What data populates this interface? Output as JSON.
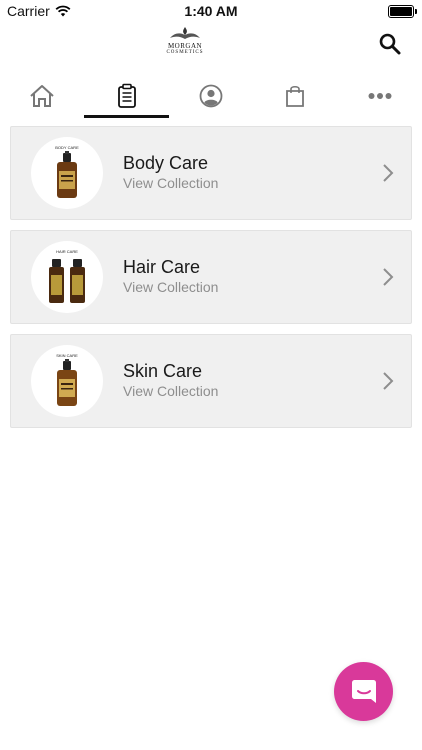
{
  "status_bar": {
    "carrier": "Carrier",
    "time": "1:40 AM"
  },
  "header": {
    "logo_brand": "MORGAN",
    "logo_sub": "COSMETICS",
    "search_icon": "search-icon"
  },
  "tabs": [
    {
      "icon": "home-icon",
      "active": false
    },
    {
      "icon": "clipboard-icon",
      "active": true
    },
    {
      "icon": "profile-icon",
      "active": false
    },
    {
      "icon": "shopping-bag-icon",
      "active": false
    },
    {
      "icon": "more-icon",
      "active": false
    }
  ],
  "collections": [
    {
      "title": "Body Care",
      "subtitle": "View Collection",
      "thumb_label": "BODY CARE"
    },
    {
      "title": "Hair Care",
      "subtitle": "View Collection",
      "thumb_label": "HAIR CARE"
    },
    {
      "title": "Skin Care",
      "subtitle": "View Collection",
      "thumb_label": "SKIN CARE"
    }
  ],
  "fab": {
    "icon": "chat-icon"
  },
  "colors": {
    "accent": "#d9399a",
    "card_bg": "#f0f0f0",
    "subtitle": "#8e8e8e",
    "active_tab": "#111111"
  }
}
